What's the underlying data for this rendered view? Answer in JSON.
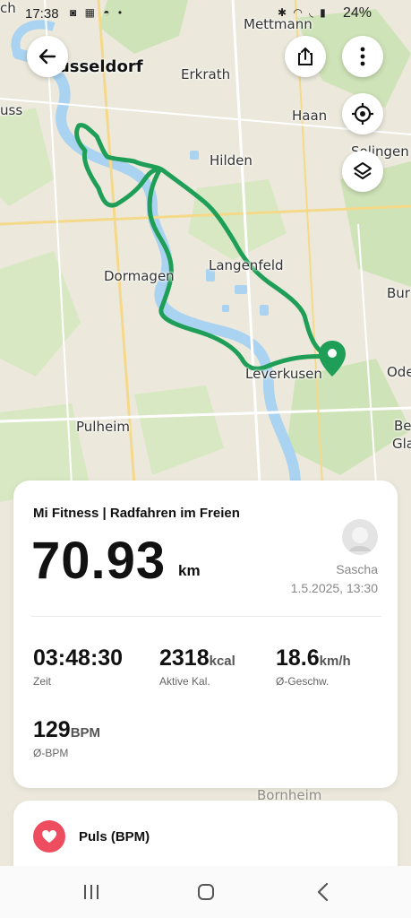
{
  "status_bar": {
    "time": "17:38",
    "battery": "24%"
  },
  "map": {
    "labels": {
      "duesseldorf": "Düsseldorf",
      "mettmann": "Mettmann",
      "erkrath": "Erkrath",
      "haan": "Haan",
      "solingen": "Solingen",
      "hilden": "Hilden",
      "langenfeld": "Langenfeld",
      "dormagen": "Dormagen",
      "leverkusen": "Leverkusen",
      "bur": "Bur",
      "ode": "Ode",
      "pulheim": "Pulheim",
      "be": "Be",
      "gla": "Gla",
      "uss": "uss",
      "ch": "ch",
      "bornheim": "Bornheim"
    },
    "route_color": "#1f9e57"
  },
  "card": {
    "title": "Mi Fitness | Radfahren im Freien",
    "distance": "70.93",
    "distance_unit": "km",
    "user_name": "Sascha",
    "date_time": "1.5.2025, 13:30",
    "stats": {
      "time": {
        "value": "03:48:30",
        "label": "Zeit"
      },
      "calories": {
        "value": "2318",
        "unit": "kcal",
        "label": "Aktive Kal."
      },
      "speed": {
        "value": "18.6",
        "unit": "km/h",
        "label": "Ø-Geschw."
      },
      "bpm": {
        "value": "129",
        "unit": "BPM",
        "label": "Ø-BPM"
      }
    }
  },
  "pulse_card": {
    "title": "Puls (BPM)",
    "accent": "#ee4d5f"
  }
}
